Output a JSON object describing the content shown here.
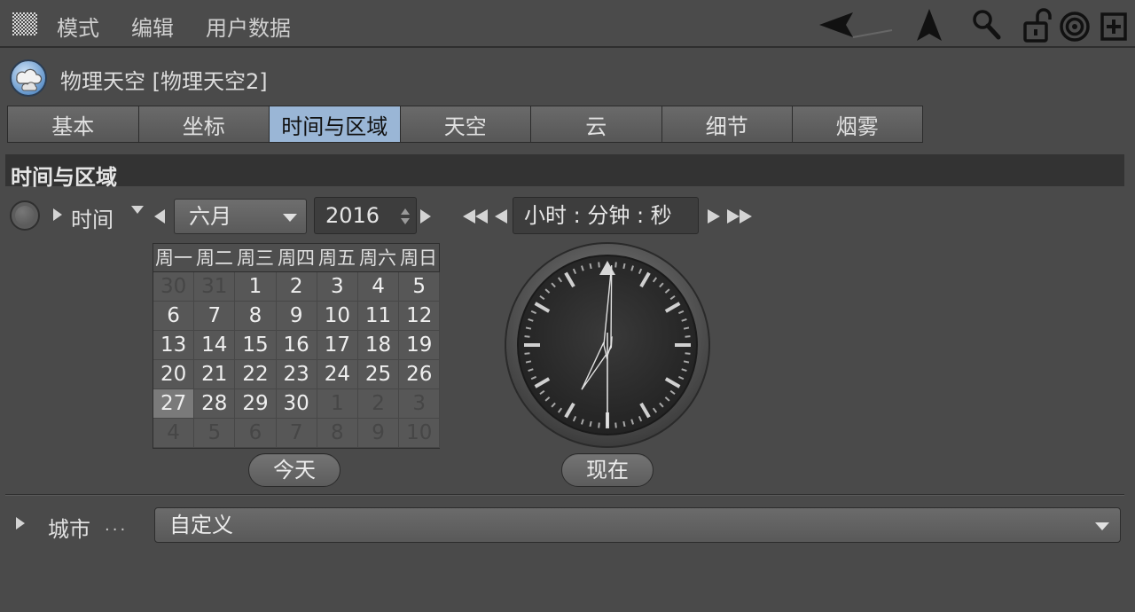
{
  "menubar": {
    "items": [
      "模式",
      "编辑",
      "用户数据"
    ],
    "icons": [
      "back-arrow-icon",
      "up-arrow-icon",
      "search-icon",
      "unlock-icon",
      "target-icon",
      "add-panel-icon"
    ]
  },
  "object": {
    "title": "物理天空 [物理天空2]",
    "icon": "physical-sky-icon"
  },
  "tabs": [
    {
      "label": "基本",
      "active": false
    },
    {
      "label": "坐标",
      "active": false
    },
    {
      "label": "时间与区域",
      "active": true
    },
    {
      "label": "天空",
      "active": false
    },
    {
      "label": "云",
      "active": false
    },
    {
      "label": "细节",
      "active": false
    },
    {
      "label": "烟雾",
      "active": false
    }
  ],
  "section": {
    "title": "时间与区域"
  },
  "time": {
    "label": "时间",
    "month": "六月",
    "year": "2016",
    "time_placeholder": "小时 : 分钟 : 秒",
    "clock": {
      "hour": 7,
      "minute": 0,
      "second": 30
    }
  },
  "calendar": {
    "weekdays": [
      "周一",
      "周二",
      "周三",
      "周四",
      "周五",
      "周六",
      "周日"
    ],
    "weeks": [
      [
        {
          "d": "30",
          "o": true
        },
        {
          "d": "31",
          "o": true
        },
        {
          "d": "1"
        },
        {
          "d": "2"
        },
        {
          "d": "3"
        },
        {
          "d": "4"
        },
        {
          "d": "5"
        }
      ],
      [
        {
          "d": "6"
        },
        {
          "d": "7"
        },
        {
          "d": "8"
        },
        {
          "d": "9"
        },
        {
          "d": "10"
        },
        {
          "d": "11"
        },
        {
          "d": "12"
        }
      ],
      [
        {
          "d": "13"
        },
        {
          "d": "14"
        },
        {
          "d": "15"
        },
        {
          "d": "16"
        },
        {
          "d": "17"
        },
        {
          "d": "18"
        },
        {
          "d": "19"
        }
      ],
      [
        {
          "d": "20"
        },
        {
          "d": "21"
        },
        {
          "d": "22"
        },
        {
          "d": "23"
        },
        {
          "d": "24"
        },
        {
          "d": "25"
        },
        {
          "d": "26"
        }
      ],
      [
        {
          "d": "27",
          "t": true
        },
        {
          "d": "28"
        },
        {
          "d": "29"
        },
        {
          "d": "30"
        },
        {
          "d": "1",
          "o": true
        },
        {
          "d": "2",
          "o": true
        },
        {
          "d": "3",
          "o": true
        }
      ],
      [
        {
          "d": "4",
          "o": true
        },
        {
          "d": "5",
          "o": true
        },
        {
          "d": "6",
          "o": true
        },
        {
          "d": "7",
          "o": true
        },
        {
          "d": "8",
          "o": true
        },
        {
          "d": "9",
          "o": true
        },
        {
          "d": "10",
          "o": true
        }
      ]
    ],
    "today_button": "今天"
  },
  "now_button": "现在",
  "city": {
    "label": "城市",
    "dots": "...",
    "value": "自定义"
  },
  "colors": {
    "active_tab": "#9ab6d6",
    "background": "#4a4a4a"
  }
}
